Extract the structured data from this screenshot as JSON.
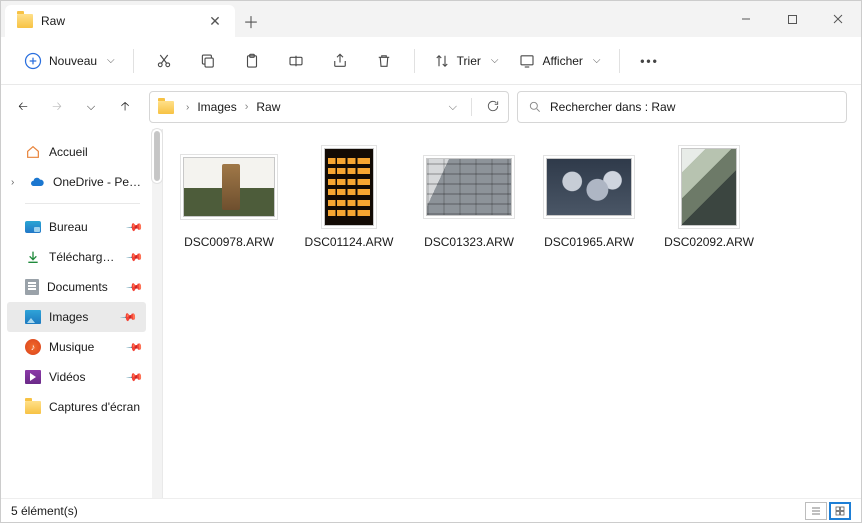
{
  "window": {
    "tab_title": "Raw",
    "min": "—",
    "max": "▢",
    "close": "✕"
  },
  "toolbar": {
    "new_label": "Nouveau",
    "sort_label": "Trier",
    "view_label": "Afficher",
    "more": "•••"
  },
  "breadcrumb": {
    "seg1": "Images",
    "seg2": "Raw"
  },
  "search": {
    "placeholder": "Rechercher dans : Raw"
  },
  "sidebar": {
    "home": "Accueil",
    "onedrive": "OneDrive - Personnel",
    "desktop": "Bureau",
    "downloads": "Téléchargements",
    "documents": "Documents",
    "images": "Images",
    "music": "Musique",
    "videos": "Vidéos",
    "captures": "Captures d'écran"
  },
  "files": [
    {
      "name": "DSC00978.ARW"
    },
    {
      "name": "DSC01124.ARW"
    },
    {
      "name": "DSC01323.ARW"
    },
    {
      "name": "DSC01965.ARW"
    },
    {
      "name": "DSC02092.ARW"
    }
  ],
  "status": {
    "count_label": "5 élément(s)"
  }
}
